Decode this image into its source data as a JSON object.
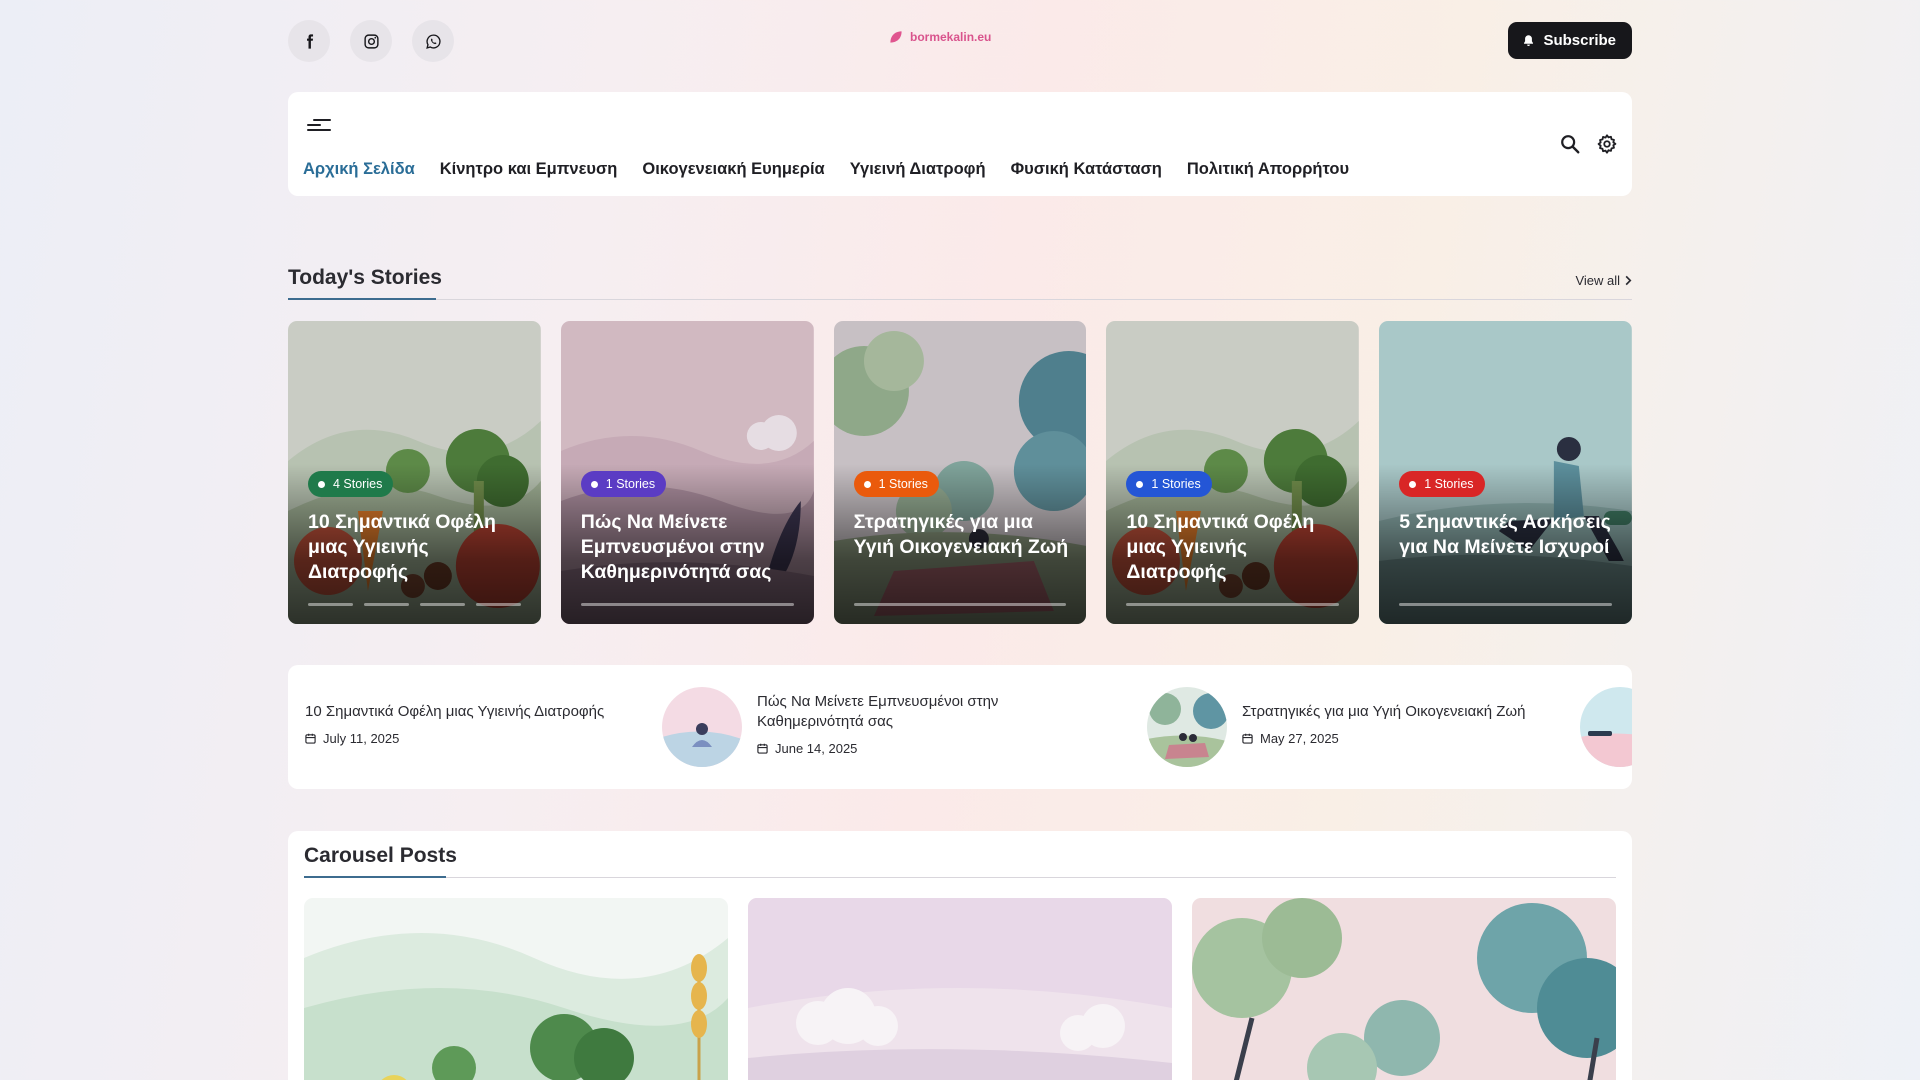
{
  "header": {
    "social": [
      {
        "name": "facebook-icon"
      },
      {
        "name": "instagram-icon"
      },
      {
        "name": "whatsapp-icon"
      }
    ],
    "logo_text": "bormekalin.eu",
    "subscribe_label": "Subscribe",
    "brand_color": "#d9548d"
  },
  "nav": {
    "items": [
      {
        "label": "Αρχική Σελίδα",
        "active": true
      },
      {
        "label": "Κίνητρο και Εμπνευση"
      },
      {
        "label": "Οικογενειακή Ευημερία"
      },
      {
        "label": "Υγιεινή Διατροφή"
      },
      {
        "label": "Φυσική Κατάσταση"
      },
      {
        "label": "Πολιτική Απορρήτου"
      }
    ],
    "active_color": "#2a6d97"
  },
  "stories_section": {
    "title": "Today's Stories",
    "view_all": "View all",
    "cards": [
      {
        "badge": "4 Stories",
        "badge_color": "#1f7a4a",
        "title": "10 Σημαντικά Οφέλη μιας Υγιεινής Διατροφής",
        "segments": 4
      },
      {
        "badge": "1 Stories",
        "badge_color": "#5b3cc4",
        "title": "Πώς Να Μείνετε Εμπνευσμένοι στην Καθημερινότητά σας",
        "segments": 1
      },
      {
        "badge": "1 Stories",
        "badge_color": "#ea5a0c",
        "title": "Στρατηγικές για μια Υγιή Οικογενειακή Ζωή",
        "segments": 1
      },
      {
        "badge": "1 Stories",
        "badge_color": "#2456d6",
        "title": "10 Σημαντικά Οφέλη μιας Υγιεινής Διατροφής",
        "segments": 1
      },
      {
        "badge": "1 Stories",
        "badge_color": "#d92626",
        "title": "5 Σημαντικές Ασκήσεις για Να Μείνετε Ισχυροί",
        "segments": 1
      }
    ]
  },
  "ticker": {
    "items": [
      {
        "title": "10 Σημαντικά Οφέλη μιας Υγιεινής Διατροφής",
        "date": "July 11, 2025"
      },
      {
        "title": "Πώς Να Μείνετε Εμπνευσμένοι στην Καθημερινότητά σας",
        "date": "June 14, 2025"
      },
      {
        "title": "Στρατηγικές για μια Υγιή Οικογενειακή Ζωή",
        "date": "May 27, 2025"
      }
    ]
  },
  "carousel": {
    "title": "Carousel Posts"
  }
}
